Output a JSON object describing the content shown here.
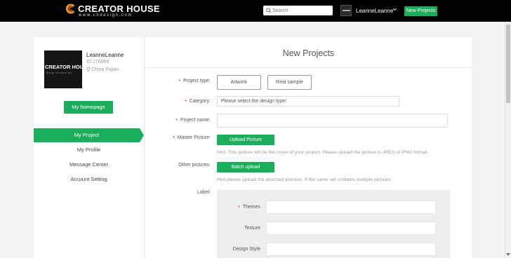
{
  "header": {
    "logo_title": "CREATOR HOUSE",
    "logo_subtitle": "www.chdesign.com",
    "search_placeholder": "Search",
    "user_name": "LeanneLeanne",
    "new_projects_button": "New Projects"
  },
  "profile": {
    "avatar_title": "CREATOR HOUSE",
    "avatar_subtitle": "www.chdesign",
    "name": "LeanneLeanne",
    "id": "ID:176895",
    "location": "China Fujian",
    "homepage_button": "My homepage"
  },
  "nav": {
    "items": [
      {
        "label": "My Project",
        "active": true
      },
      {
        "label": "My Profile",
        "active": false
      },
      {
        "label": "Message Center",
        "active": false
      },
      {
        "label": "Account Setting",
        "active": false
      }
    ]
  },
  "form": {
    "title": "New Projects",
    "project_type_label": "Project type:",
    "project_type_options": [
      "Artwork",
      "Real sample"
    ],
    "category_label": "Category:",
    "category_value": "Please select the design type!",
    "project_name_label": "Project name:",
    "project_name_value": "",
    "master_picture_label": "Master Picture:",
    "upload_button": "Upload Picture",
    "master_hint": "Hint: This picture will be the cover of your project. Please upload the picture in JPEG or PNG format.",
    "other_pictures_label": "Other pictures:",
    "batch_button": "Batch upload",
    "other_hint": "Hint:please upload the attached pictures. If the same set contains multiple pictures.",
    "label_label": "Label:",
    "label_fields": [
      {
        "label": "Themes",
        "required": true
      },
      {
        "label": "Texture",
        "required": false
      },
      {
        "label": "Design Style",
        "required": false
      }
    ],
    "required_mark": "•"
  },
  "colors": {
    "accent": "#1aad5b",
    "required": "#e4393c",
    "topbar": "#000000"
  },
  "icons": [
    "search-icon",
    "chevron-down-icon",
    "location-pin-icon",
    "logo-mark-icon"
  ]
}
